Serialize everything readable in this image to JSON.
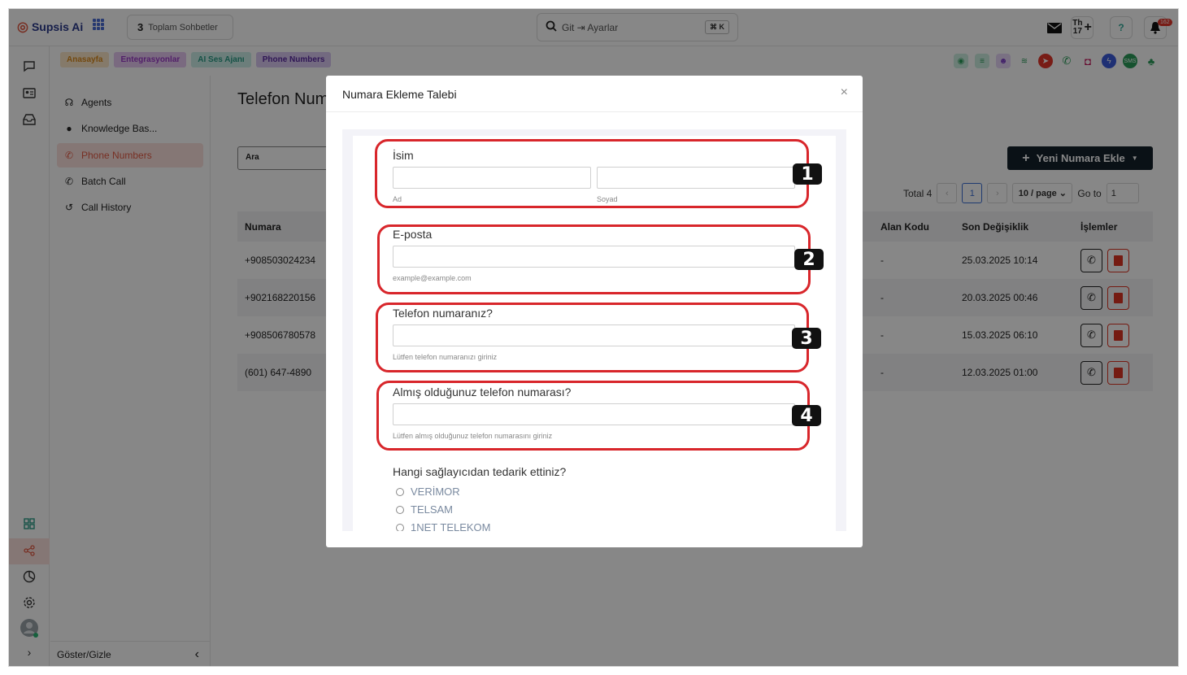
{
  "app": {
    "brand": "Supsis Ai",
    "conversations_count": "3",
    "conversations_label": "Toplam Sohbetler"
  },
  "search": {
    "placeholder": "Git ⇥ Ayarlar",
    "shortcut": "⌘ K"
  },
  "header": {
    "calendar_day": "Th",
    "calendar_date": "17",
    "notifications": "162"
  },
  "breadcrumbs": [
    {
      "label": "Anasayfa",
      "bg": "#fbe6c8",
      "color": "#d98a1e"
    },
    {
      "label": "Entegrasyonlar",
      "bg": "#e6c9f2",
      "color": "#9b3cc7"
    },
    {
      "label": "AI Ses Ajanı",
      "bg": "#cdeee8",
      "color": "#2a9c86"
    },
    {
      "label": "Phone Numbers",
      "bg": "#d9c9f2",
      "color": "#5a2aa0"
    }
  ],
  "sidebar": {
    "items": [
      {
        "label": "Agents",
        "icon": "headset-icon"
      },
      {
        "label": "Knowledge Bas...",
        "icon": "brain-icon"
      },
      {
        "label": "Phone Numbers",
        "icon": "phone-icon"
      },
      {
        "label": "Batch Call",
        "icon": "phone-icon"
      },
      {
        "label": "Call History",
        "icon": "history-icon"
      }
    ],
    "toggle_label": "Göster/Gizle"
  },
  "main": {
    "title": "Telefon Numaraları",
    "search_placeholder": "Ara",
    "new_button": "Yeni Numara Ekle",
    "pagination": {
      "total": "Total 4",
      "current_page": "1",
      "page_size": "10 / page",
      "goto_label": "Go to",
      "goto_value": "1"
    },
    "table": {
      "headers": {
        "number": "Numara",
        "area_code": "Alan Kodu",
        "last_change": "Son Değişiklik",
        "actions": "İşlemler"
      },
      "rows": [
        {
          "number": "+908503024234",
          "area_code": "-",
          "last_change": "25.03.2025 10:14"
        },
        {
          "number": "+902168220156",
          "area_code": "-",
          "last_change": "20.03.2025 00:46"
        },
        {
          "number": "+908506780578",
          "area_code": "-",
          "last_change": "15.03.2025 06:10"
        },
        {
          "number": "(601) 647-4890",
          "area_code": "-",
          "last_change": "12.03.2025 01:00"
        }
      ]
    }
  },
  "modal": {
    "title": "Numara Ekleme Talebi",
    "close": "×",
    "form": {
      "name_label": "İsim",
      "first_hint": "Ad",
      "last_hint": "Soyad",
      "email_label": "E-posta",
      "email_hint": "example@example.com",
      "phone_label": "Telefon numaranız?",
      "phone_hint": "Lütfen telefon numaranızı giriniz",
      "bought_label": "Almış olduğunuz telefon numarası?",
      "bought_hint": "Lütfen almış olduğunuz telefon numarasını giriniz",
      "provider_label": "Hangi sağlayıcıdan tedarik ettiniz?",
      "providers": [
        "VERİMOR",
        "TELSAM",
        "1NET TELEKOM"
      ]
    },
    "markers": [
      "1",
      "2",
      "3",
      "4"
    ]
  },
  "colors": {
    "accent": "#e25b45",
    "primary_dark": "#13202b",
    "highlight_red": "#d8262b",
    "danger": "#dd3322"
  }
}
